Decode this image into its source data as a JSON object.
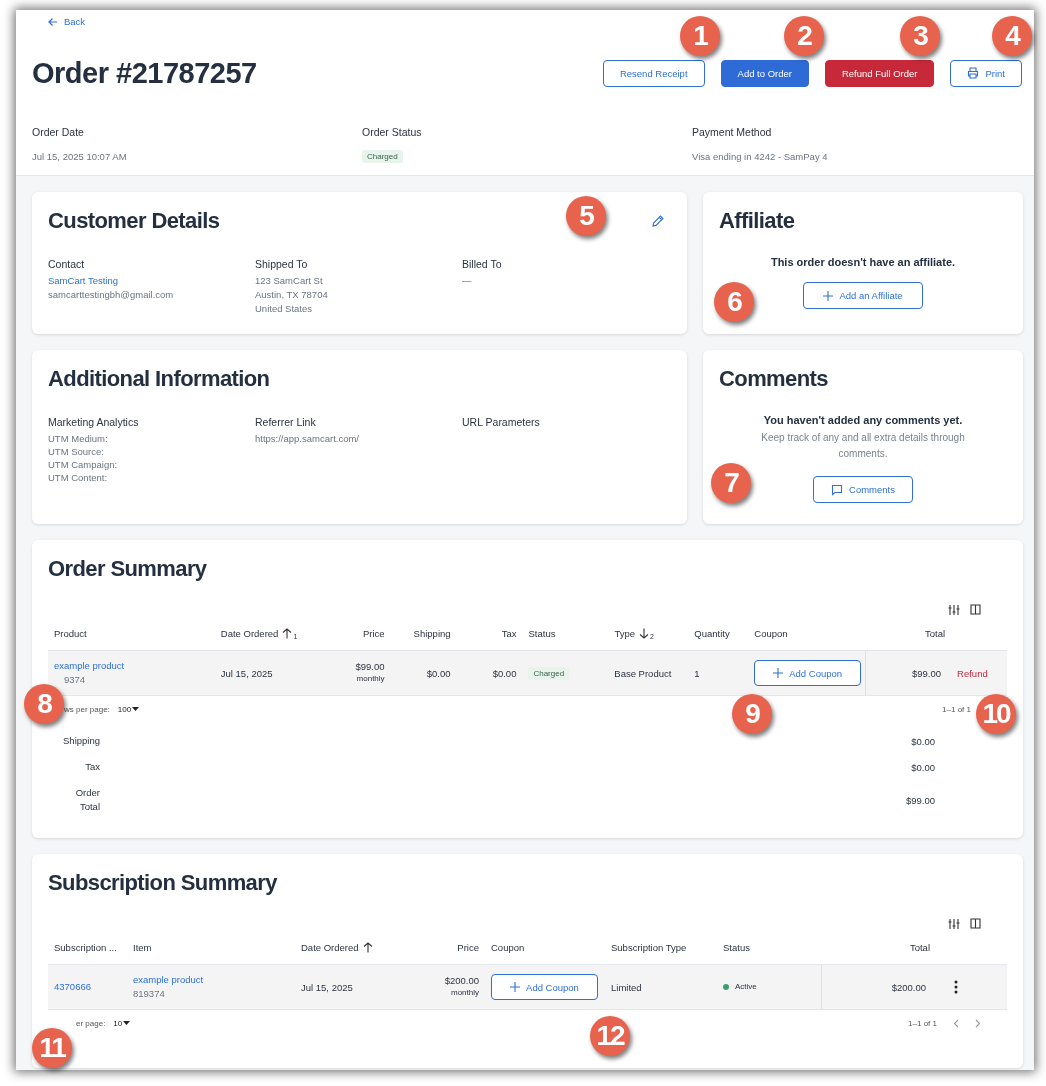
{
  "back_link": "Back",
  "title": "Order #21787257",
  "actions": [
    {
      "label": "Resend Receipt",
      "kind": "outline"
    },
    {
      "label": "Add to Order",
      "kind": "primary"
    },
    {
      "label": "Refund Full Order",
      "kind": "danger"
    },
    {
      "label": "Print",
      "kind": "print"
    }
  ],
  "meta": [
    {
      "label": "Order Date",
      "value": "Jul 15, 2025 10:07 AM",
      "kind": "text"
    },
    {
      "label": "Order Status",
      "value": "Charged",
      "kind": "badge"
    },
    {
      "label": "Payment Method",
      "value": "Visa ending in 4242 - SamPay 4",
      "kind": "text"
    }
  ],
  "customer_details": {
    "title": "Customer Details",
    "columns": [
      {
        "label": "Contact",
        "lines": [
          {
            "text": "SamCart Testing",
            "kind": "link"
          },
          {
            "text": "samcarttestingbh@gmail.com",
            "kind": "text"
          }
        ]
      },
      {
        "label": "Shipped To",
        "lines": [
          {
            "text": "123 SamCart St",
            "kind": "text"
          },
          {
            "text": "Austin, TX 78704",
            "kind": "text"
          },
          {
            "text": "United States",
            "kind": "text"
          }
        ]
      },
      {
        "label": "Billed To",
        "lines": [
          {
            "text": "—",
            "kind": "text"
          }
        ]
      }
    ]
  },
  "affiliate": {
    "title": "Affiliate",
    "message": "This order doesn't have an affiliate.",
    "button": "Add an Affiliate"
  },
  "additional_information": {
    "title": "Additional Information",
    "columns": [
      {
        "label": "Marketing Analytics",
        "lines": [
          "UTM Medium:",
          "UTM Source:",
          "UTM Campaign:",
          "UTM Content:"
        ]
      },
      {
        "label": "Referrer Link",
        "lines": [
          "https://app.samcart.com/"
        ]
      },
      {
        "label": "URL Parameters"
      }
    ]
  },
  "comments": {
    "title": "Comments",
    "message": "You haven't added any comments yet.",
    "hint": "Keep track of any and all extra details through comments.",
    "button": "Comments"
  },
  "order_summary": {
    "title": "Order Summary",
    "columns": [
      {
        "label": "Product"
      },
      {
        "label": "Date Ordered",
        "sort_descending": false,
        "sort_rank": "1"
      },
      {
        "label": "Price"
      },
      {
        "label": "Shipping"
      },
      {
        "label": "Tax"
      },
      {
        "label": "Status"
      },
      {
        "label": "Type",
        "sort_descending": true,
        "sort_rank": "2"
      },
      {
        "label": "Quantity"
      },
      {
        "label": "Coupon"
      },
      {
        "label": "Total"
      }
    ],
    "rows": [
      {
        "product": "example product",
        "sku": "9374",
        "date": "Jul 15, 2025",
        "price": "$99.00",
        "price_period": "monthly",
        "shipping": "$0.00",
        "tax": "$0.00",
        "status": "Charged",
        "type": "Base Product",
        "quantity": "1",
        "coupon_button": "Add Coupon",
        "total": "$99.00",
        "action": "Refund"
      }
    ],
    "rows_per_page_label": "ws per page:",
    "rows_per_page": "100",
    "pagination": "1–1 of 1",
    "totals": [
      {
        "label": "Shipping",
        "value": "$0.00"
      },
      {
        "label": "Tax",
        "value": "$0.00"
      },
      {
        "label": "Order Total",
        "value": "$99.00"
      }
    ]
  },
  "subscription_summary": {
    "title": "Subscription Summary",
    "columns": [
      {
        "label": "Subscription ..."
      },
      {
        "label": "Item"
      },
      {
        "label": "Date Ordered",
        "sort_descending": false
      },
      {
        "label": "Price"
      },
      {
        "label": "Coupon"
      },
      {
        "label": "Subscription Type"
      },
      {
        "label": "Status"
      },
      {
        "label": "Total"
      }
    ],
    "rows": [
      {
        "id": "4370666",
        "item": "example product",
        "sku": "819374",
        "date": "Jul 15, 2025",
        "price": "$200.00",
        "price_period": "monthly",
        "coupon_button": "Add Coupon",
        "subscription_type": "Limited",
        "status": "Active",
        "color": "#3f9f6a",
        "total": "$200.00"
      }
    ],
    "rows_per_page_label": "er page:",
    "rows_per_page": "10",
    "pagination": "1–1 of 1"
  },
  "callouts": [
    "1",
    "2",
    "3",
    "4",
    "5",
    "6",
    "7",
    "8",
    "9",
    "10",
    "11",
    "12"
  ]
}
